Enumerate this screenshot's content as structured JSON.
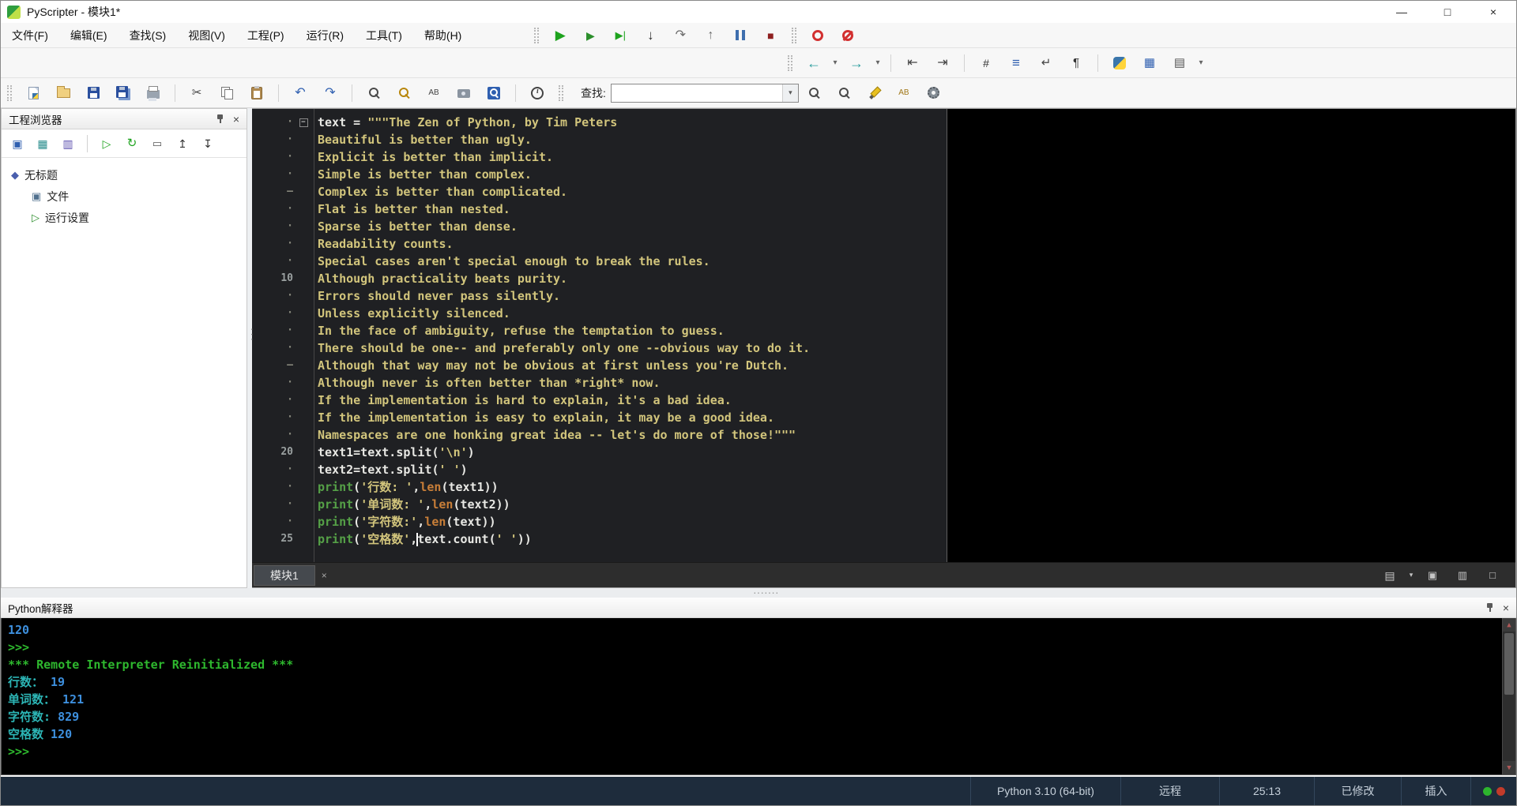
{
  "colors": {
    "toolbar_bg": "#f7f7f7",
    "editor_bg": "#1f2023",
    "console_bg": "#000000",
    "string": "#d2c57c",
    "code_default": "#e8e8e4",
    "print_builtin": "#55a047",
    "len_builtin": "#c87e38",
    "console_number": "#3d8fdd",
    "console_prompt": "#2eb82e",
    "console_output": "#2cb5b5",
    "statusbar_bg": "#1e2c3c",
    "statusbar_text": "#c6d0da",
    "indicator_green": "#2db52d",
    "indicator_red": "#c23b2a"
  },
  "window": {
    "title": "PyScripter - 模块1*",
    "minimize_glyph": "—",
    "maximize_glyph": "□",
    "close_glyph": "×"
  },
  "menubar": {
    "items": [
      {
        "label": "文件(F)",
        "name": "menu-file"
      },
      {
        "label": "编辑(E)",
        "name": "menu-edit"
      },
      {
        "label": "查找(S)",
        "name": "menu-search"
      },
      {
        "label": "视图(V)",
        "name": "menu-view"
      },
      {
        "label": "工程(P)",
        "name": "menu-project"
      },
      {
        "label": "运行(R)",
        "name": "menu-run"
      },
      {
        "label": "工具(T)",
        "name": "menu-tools"
      },
      {
        "label": "帮助(H)",
        "name": "menu-help"
      }
    ]
  },
  "find": {
    "label": "查找:",
    "value": ""
  },
  "toolbars": {
    "run": [
      {
        "type": "grip"
      },
      {
        "name": "run",
        "glyph": "▶",
        "color": "#1ea31e",
        "size": 17
      },
      {
        "name": "debug",
        "glyph": "▶",
        "color": "#2c8f2c",
        "size": 14
      },
      {
        "name": "step-into",
        "glyph": "▶|",
        "color": "#1ea31e",
        "size": 13
      },
      {
        "name": "run-to-cursor",
        "glyph": "↓",
        "color": "#303030",
        "size": 17
      },
      {
        "name": "step-over",
        "glyph": "↷",
        "color": "#6a6a6a",
        "size": 16
      },
      {
        "name": "step-out",
        "glyph": "↑",
        "color": "#6a6a6a",
        "size": 16
      },
      {
        "name": "pause",
        "css": "ic-pause"
      },
      {
        "name": "stop",
        "glyph": "■",
        "color": "#8e2020",
        "size": 14
      },
      {
        "type": "grip"
      },
      {
        "name": "toggle-breakpoint",
        "css": "ic-ring"
      },
      {
        "name": "clear-breakpoints",
        "css": "ic-ring-slash"
      }
    ],
    "view": [
      {
        "type": "grip"
      },
      {
        "name": "navigate-back",
        "glyph": "←",
        "color": "#2a9d9d",
        "size": 18
      },
      {
        "name": "navigate-back-options",
        "glyph": "▾",
        "color": "#666",
        "size": 10,
        "narrow": true
      },
      {
        "name": "navigate-forward",
        "glyph": "→",
        "color": "#2a9d9d",
        "size": 18
      },
      {
        "name": "navigate-forward-options",
        "glyph": "▾",
        "color": "#666",
        "size": 10,
        "narrow": true
      },
      {
        "type": "sep"
      },
      {
        "name": "dedent-block",
        "glyph": "⇤",
        "color": "#444",
        "size": 16
      },
      {
        "name": "indent-block",
        "glyph": "⇥",
        "color": "#444",
        "size": 16
      },
      {
        "type": "sep"
      },
      {
        "name": "toggle-comment",
        "glyph": "#",
        "color": "#333",
        "size": 14
      },
      {
        "name": "line-numbers",
        "glyph": "≡",
        "color": "#2f5fb0",
        "size": 17
      },
      {
        "name": "word-wrap",
        "glyph": "↵",
        "color": "#444",
        "size": 15
      },
      {
        "name": "special-characters",
        "glyph": "¶",
        "color": "#333",
        "size": 15
      },
      {
        "type": "sep"
      },
      {
        "name": "python-engine",
        "css": "ic-python"
      },
      {
        "name": "code-browser",
        "glyph": "▦",
        "color": "#2f5fb0",
        "size": 15
      },
      {
        "name": "layouts",
        "glyph": "▤",
        "color": "#555",
        "size": 15
      },
      {
        "name": "layouts-options",
        "glyph": "▾",
        "color": "#666",
        "size": 10,
        "narrow": true
      }
    ],
    "main": [
      {
        "type": "grip"
      },
      {
        "name": "new-file",
        "css": "ic-doc ic-doc-py"
      },
      {
        "name": "open-file",
        "css": "ic-folder"
      },
      {
        "name": "save",
        "css": "ic-floppy"
      },
      {
        "name": "save-all",
        "css": "ic-floppy ic-floppy-all"
      },
      {
        "name": "print",
        "css": "ic-printer"
      },
      {
        "type": "sep"
      },
      {
        "name": "cut",
        "glyph": "✂",
        "color": "#444",
        "size": 15
      },
      {
        "name": "copy",
        "css": "ic-copy"
      },
      {
        "name": "paste",
        "css": "ic-paste"
      },
      {
        "type": "sep"
      },
      {
        "name": "undo",
        "glyph": "↶",
        "color": "#2f5fb0",
        "size": 16
      },
      {
        "name": "redo",
        "glyph": "↷",
        "color": "#2f5fb0",
        "size": 16
      },
      {
        "type": "sep"
      },
      {
        "name": "search",
        "css": "ic-search"
      },
      {
        "name": "incremental-search",
        "css": "ic-search ic-search-gold"
      },
      {
        "name": "replace",
        "glyph": "AB",
        "color": "#444",
        "size": 10
      },
      {
        "name": "find-in-files",
        "css": "ic-camera"
      },
      {
        "name": "search-in-selection",
        "css": "ic-bluebox"
      },
      {
        "type": "sep"
      },
      {
        "name": "info",
        "css": "ic-info"
      },
      {
        "type": "grip"
      },
      {
        "type": "label",
        "name": "find-label",
        "bind": "find.label"
      },
      {
        "type": "combo"
      },
      {
        "name": "find-next",
        "css": "ic-search"
      },
      {
        "name": "find-previous",
        "css": "ic-search"
      },
      {
        "name": "highlight-search",
        "css": "ic-pen"
      },
      {
        "name": "match-case",
        "glyph": "AB",
        "color": "#a07818",
        "size": 10
      },
      {
        "name": "search-options",
        "css": "ic-gear"
      }
    ],
    "project": [
      {
        "name": "project-new",
        "glyph": "▣",
        "color": "#2f5fb0",
        "size": 14
      },
      {
        "name": "project-packages",
        "glyph": "▦",
        "color": "#2a8d8d",
        "size": 14
      },
      {
        "name": "project-modules",
        "glyph": "▥",
        "color": "#5a4fae",
        "size": 14
      },
      {
        "type": "sep"
      },
      {
        "name": "project-run",
        "glyph": "▷",
        "color": "#1ea31e",
        "size": 14
      },
      {
        "name": "project-refresh",
        "glyph": "↻",
        "color": "#1ea31e",
        "size": 15
      },
      {
        "name": "project-window",
        "glyph": "▭",
        "color": "#555",
        "size": 13
      },
      {
        "name": "project-collapse-all",
        "glyph": "↥",
        "color": "#333",
        "size": 14
      },
      {
        "name": "project-expand-all",
        "glyph": "↧",
        "color": "#333",
        "size": 14
      }
    ],
    "tab_right": [
      {
        "name": "editor-list",
        "glyph": "▤",
        "color": "#c6c6c6",
        "size": 14
      },
      {
        "name": "editor-list-options",
        "glyph": "▾",
        "color": "#c6c6c6",
        "size": 9,
        "narrow": true
      },
      {
        "name": "dock-editor",
        "glyph": "▣",
        "color": "#c6c6c6",
        "size": 13
      },
      {
        "name": "undock-editor",
        "glyph": "▥",
        "color": "#c6c6c6",
        "size": 13
      },
      {
        "name": "new-editor-window",
        "glyph": "□",
        "color": "#c6c6c6",
        "size": 13
      }
    ]
  },
  "project_explorer": {
    "title": "工程浏览器",
    "tree": [
      {
        "label": "无标题",
        "level": 0,
        "name": "untitled-project",
        "icon": "project-root-icon",
        "glyph": "◆",
        "color": "#4a5fae"
      },
      {
        "label": "文件",
        "level": 1,
        "name": "files",
        "icon": "files-node-icon",
        "glyph": "▣",
        "color": "#50708e"
      },
      {
        "label": "运行设置",
        "level": 1,
        "name": "run-settings",
        "icon": "run-config-node-icon",
        "glyph": "▷",
        "color": "#2f8f2f"
      }
    ]
  },
  "editor": {
    "tab_label": "模块1",
    "gutter": [
      {
        "m": "·",
        "fold": true
      },
      {
        "m": "·"
      },
      {
        "m": "·"
      },
      {
        "m": "·"
      },
      {
        "m": "–"
      },
      {
        "m": "·"
      },
      {
        "m": "·"
      },
      {
        "m": "·"
      },
      {
        "m": "·"
      },
      {
        "m": "10"
      },
      {
        "m": "·"
      },
      {
        "m": "·"
      },
      {
        "m": "·"
      },
      {
        "m": "·"
      },
      {
        "m": "–"
      },
      {
        "m": "·"
      },
      {
        "m": "·"
      },
      {
        "m": "·"
      },
      {
        "m": "·"
      },
      {
        "m": "20"
      },
      {
        "m": "·"
      },
      {
        "m": "·"
      },
      {
        "m": "·"
      },
      {
        "m": "·"
      },
      {
        "m": "25"
      }
    ],
    "lines": [
      [
        {
          "t": "text = ",
          "c": "d"
        },
        {
          "t": "\"\"\"The Zen of Python, by Tim Peters",
          "c": "s"
        }
      ],
      [
        {
          "t": "Beautiful is better than ugly.",
          "c": "s"
        }
      ],
      [
        {
          "t": "Explicit is better than implicit.",
          "c": "s"
        }
      ],
      [
        {
          "t": "Simple is better than complex.",
          "c": "s"
        }
      ],
      [
        {
          "t": "Complex is better than complicated.",
          "c": "s"
        }
      ],
      [
        {
          "t": "Flat is better than nested.",
          "c": "s"
        }
      ],
      [
        {
          "t": "Sparse is better than dense.",
          "c": "s"
        }
      ],
      [
        {
          "t": "Readability counts.",
          "c": "s"
        }
      ],
      [
        {
          "t": "Special cases aren't special enough to break the rules.",
          "c": "s"
        }
      ],
      [
        {
          "t": "Although practicality beats purity.",
          "c": "s"
        }
      ],
      [
        {
          "t": "Errors should never pass silently.",
          "c": "s"
        }
      ],
      [
        {
          "t": "Unless explicitly silenced.",
          "c": "s"
        }
      ],
      [
        {
          "t": "In the face of ambiguity, refuse the temptation to guess.",
          "c": "s"
        }
      ],
      [
        {
          "t": "There should be one-- and preferably only one --obvious way to do it.",
          "c": "s"
        }
      ],
      [
        {
          "t": "Although that way may not be obvious at first unless you're Dutch.",
          "c": "s"
        }
      ],
      [
        {
          "t": "Although never is often better than *right* now.",
          "c": "s"
        }
      ],
      [
        {
          "t": "If the implementation is hard to explain, it's a bad idea.",
          "c": "s"
        }
      ],
      [
        {
          "t": "If the implementation is easy to explain, it may be a good idea.",
          "c": "s"
        }
      ],
      [
        {
          "t": "Namespaces are one honking great idea -- let's do more of those!\"\"\"",
          "c": "s"
        }
      ],
      [
        {
          "t": "text1=text.split(",
          "c": "d"
        },
        {
          "t": "'\\n'",
          "c": "s"
        },
        {
          "t": ")",
          "c": "d"
        }
      ],
      [
        {
          "t": "text2=text.split(",
          "c": "d"
        },
        {
          "t": "' '",
          "c": "s"
        },
        {
          "t": ")",
          "c": "d"
        }
      ],
      [
        {
          "t": "print",
          "c": "b"
        },
        {
          "t": "(",
          "c": "d"
        },
        {
          "t": "'行数: '",
          "c": "s"
        },
        {
          "t": ",",
          "c": "d"
        },
        {
          "t": "len",
          "c": "f"
        },
        {
          "t": "(text1))",
          "c": "d"
        }
      ],
      [
        {
          "t": "print",
          "c": "b"
        },
        {
          "t": "(",
          "c": "d"
        },
        {
          "t": "'单词数: '",
          "c": "s"
        },
        {
          "t": ",",
          "c": "d"
        },
        {
          "t": "len",
          "c": "f"
        },
        {
          "t": "(text2))",
          "c": "d"
        }
      ],
      [
        {
          "t": "print",
          "c": "b"
        },
        {
          "t": "(",
          "c": "d"
        },
        {
          "t": "'字符数:'",
          "c": "s"
        },
        {
          "t": ",",
          "c": "d"
        },
        {
          "t": "len",
          "c": "f"
        },
        {
          "t": "(text))",
          "c": "d"
        }
      ],
      [
        {
          "t": "print",
          "c": "b"
        },
        {
          "t": "(",
          "c": "d"
        },
        {
          "t": "'空格数'",
          "c": "s"
        },
        {
          "t": ",",
          "c": "d"
        },
        {
          "t": "",
          "c": "caret"
        },
        {
          "t": "text.count(",
          "c": "d"
        },
        {
          "t": "' '",
          "c": "s"
        },
        {
          "t": "))",
          "c": "d"
        }
      ]
    ]
  },
  "interpreter": {
    "title": "Python解释器",
    "lines": [
      [
        {
          "t": "120",
          "c": "num"
        }
      ],
      [
        {
          "t": ">>>",
          "c": "prompt"
        }
      ],
      [
        {
          "t": "*** Remote Interpreter Reinitialized ***",
          "c": "sys"
        }
      ],
      [
        {
          "t": "行数： ",
          "c": "out"
        },
        {
          "t": "19",
          "c": "num"
        }
      ],
      [
        {
          "t": "单词数： ",
          "c": "out"
        },
        {
          "t": "121",
          "c": "num"
        }
      ],
      [
        {
          "t": "字符数: ",
          "c": "out"
        },
        {
          "t": "829",
          "c": "num"
        }
      ],
      [
        {
          "t": "空格数 ",
          "c": "out"
        },
        {
          "t": "120",
          "c": "num"
        }
      ],
      [
        {
          "t": ">>>",
          "c": "prompt"
        }
      ]
    ]
  },
  "status_bar": {
    "items": [
      {
        "label": "Python 3.10 (64-bit)",
        "name": "status-python-version"
      },
      {
        "label": "远程",
        "name": "status-engine-remote"
      },
      {
        "label": "25:13",
        "name": "status-caret-position"
      },
      {
        "label": "已修改",
        "name": "status-modified"
      },
      {
        "label": "插入",
        "name": "status-insert-mode"
      }
    ]
  }
}
